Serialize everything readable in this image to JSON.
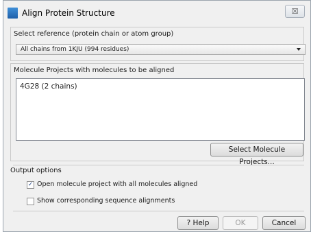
{
  "window": {
    "title": "Align Protein Structure",
    "close_glyph": "☒"
  },
  "reference": {
    "group_title": "Select reference (protein chain or atom group)",
    "selected_value": "All chains from 1KJU (994 residues)"
  },
  "molecules": {
    "group_title": "Molecule Projects with molecules to be aligned",
    "items": [
      "4G28 (2 chains)"
    ],
    "select_button": "Select Molecule Projects..."
  },
  "output": {
    "group_title": "Output options",
    "options": [
      {
        "label": "Open molecule project with all molecules aligned",
        "checked": true
      },
      {
        "label": "Show corresponding sequence alignments",
        "checked": false
      }
    ]
  },
  "footer": {
    "help_icon_glyph": "?",
    "help_label": "Help",
    "ok_label": "OK",
    "cancel_label": "Cancel"
  }
}
